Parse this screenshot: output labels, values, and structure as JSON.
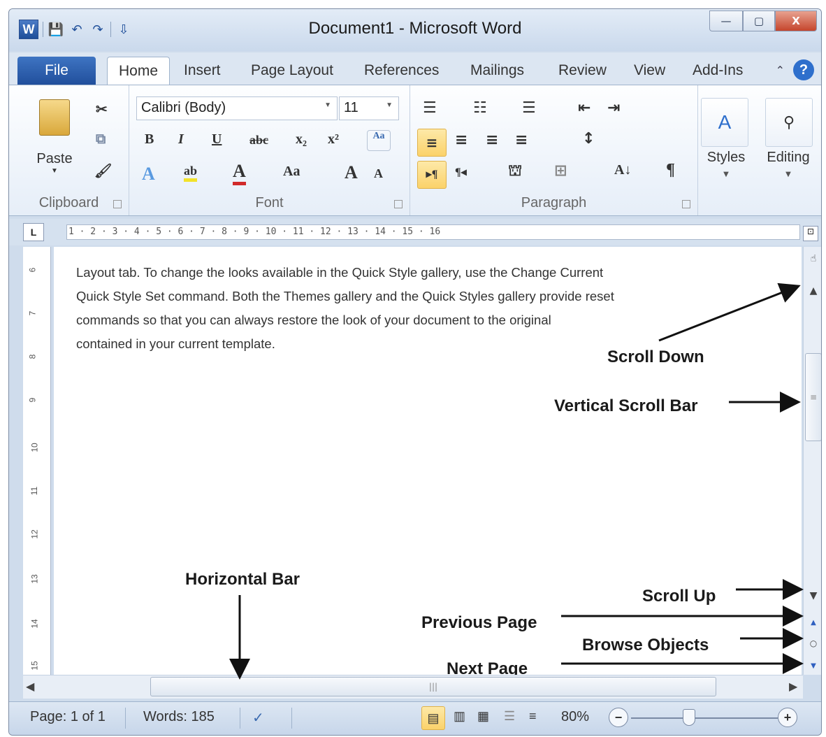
{
  "window": {
    "title": "Document1  -  Microsoft Word",
    "minimize": "—",
    "maximize": "▢",
    "close": "X"
  },
  "qat": {
    "logo": "W",
    "save": "💾",
    "undo": "↶",
    "redo": "↷",
    "customize": "⇩"
  },
  "tabs": [
    "File",
    "Home",
    "Insert",
    "Page Layout",
    "References",
    "Mailings",
    "Review",
    "View",
    "Add-Ins"
  ],
  "active_tab": "Home",
  "ribbon": {
    "clipboard": {
      "label": "Clipboard",
      "paste": "Paste",
      "cut": "✂",
      "copy": "⧉",
      "painter": "🖌"
    },
    "font": {
      "label": "Font",
      "family": "Calibri (Body)",
      "size": "11",
      "bold": "B",
      "italic": "I",
      "underline": "U",
      "strike": "abc",
      "subscript": "x₂",
      "superscript": "x²",
      "case": "Aa",
      "grow": "A",
      "shrink": "A"
    },
    "paragraph": {
      "label": "Paragraph",
      "pilcrow": "¶",
      "sort": "A↓"
    },
    "styles": {
      "label": "Styles"
    },
    "editing": {
      "label": "Editing"
    }
  },
  "ruler": {
    "tab_selector": "L",
    "scale": "1 · 2 · 3 · 4 · 5 · 6 · 7 · 8 · 9 · 10 · 11 · 12 · 13 · 14 · 15 · 16",
    "vertical": [
      "6",
      "7",
      "8",
      "9",
      "10",
      "11",
      "12",
      "13",
      "14",
      "15"
    ]
  },
  "document": {
    "lines": [
      "Layout tab. To change the looks available in the Quick Style gallery, use the Change Current",
      "Quick Style Set command. Both the Themes gallery and the Quick Styles gallery provide reset",
      "commands so that you  can always restore the look of your document to the original",
      "contained in your current template."
    ]
  },
  "callouts": {
    "scroll_down": "Scroll Down",
    "vertical_scroll_bar": "Vertical Scroll Bar",
    "horizontal_bar": "Horizontal Bar",
    "scroll_up": "Scroll Up",
    "previous_page": "Previous Page",
    "browse_objects": "Browse Objects",
    "next_page": "Next Page"
  },
  "status": {
    "page": "Page: 1 of 1",
    "words": "Words: 185",
    "zoom": "80%",
    "zoom_out": "−",
    "zoom_in": "+"
  }
}
